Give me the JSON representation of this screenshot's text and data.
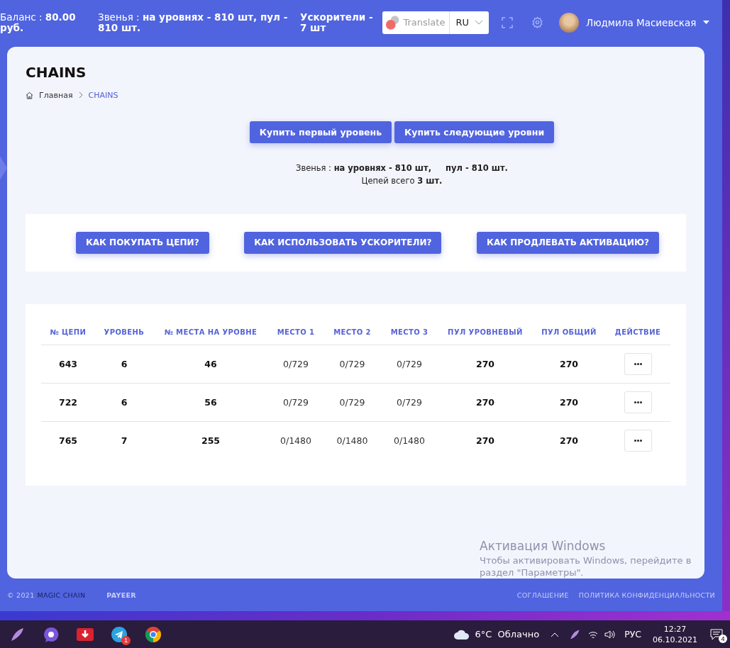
{
  "header": {
    "balance": "Баланс : **80.00 руб.**",
    "links": "Звенья : **на уровнях - 810 шт,     пул - 810 шт.**",
    "boosters": "Ускорители - 7 шт",
    "translate": {
      "label": "Translate",
      "language": "RU"
    },
    "user": {
      "name": "Людмила Масиевская"
    }
  },
  "page": {
    "title": "CHAINS",
    "breadcrumb": [
      {
        "label": "Главная",
        "current": false
      },
      {
        "label": "CHAINS",
        "current": true
      }
    ]
  },
  "buy_buttons": [
    "Купить первый уровень",
    "Купить следующие уровни"
  ],
  "summary": [
    "Звенья : **на уровнях - 810 шт,     пул - 810 шт.**",
    "Цепей всего **3 шт.**"
  ],
  "help_buttons": [
    "КАК ПОКУПАТЬ ЦЕПИ?",
    "КАК ИСПОЛЬЗОВАТЬ УСКОРИТЕЛИ?",
    "КАК ПРОДЛЕВАТЬ АКТИВАЦИЮ?"
  ],
  "table": {
    "columns": [
      {
        "label": "№ ЦЕПИ",
        "kind": "strong"
      },
      {
        "label": "УРОВЕНЬ",
        "kind": "strong"
      },
      {
        "label": "№ МЕСТА НА УРОВНЕ",
        "kind": "strong"
      },
      {
        "label": "МЕСТО 1",
        "kind": "plain"
      },
      {
        "label": "МЕСТО 2",
        "kind": "plain"
      },
      {
        "label": "МЕСТО 3",
        "kind": "plain"
      },
      {
        "label": "ПУЛ УРОВНЕВЫЙ",
        "kind": "strong"
      },
      {
        "label": "ПУЛ ОБЩИЙ",
        "kind": "strong"
      },
      {
        "label": "ДЕЙСТВИЕ",
        "kind": "action"
      }
    ],
    "rows": [
      {
        "cells": [
          "643",
          "6",
          "46",
          "0/729",
          "0/729",
          "0/729",
          "270",
          "270"
        ]
      },
      {
        "cells": [
          "722",
          "6",
          "56",
          "0/729",
          "0/729",
          "0/729",
          "270",
          "270"
        ]
      },
      {
        "cells": [
          "765",
          "7",
          "255",
          "0/1480",
          "0/1480",
          "0/1480",
          "270",
          "270"
        ]
      }
    ]
  },
  "footer": {
    "copyright": "© 2021",
    "brand": "MAGIC CHAIN",
    "payment": "PAYEER",
    "links": [
      "СОГЛАШЕНИЕ",
      "ПОЛИТИКА КОНФИДЕНЦИАЛЬНОСТИ"
    ]
  },
  "activation": {
    "title": "Активация Windows",
    "text": "Чтобы активировать Windows, перейдите в раздел \"Параметры\"."
  },
  "taskbar": {
    "apps": [
      {
        "kind": "feather"
      },
      {
        "kind": "viber"
      },
      {
        "kind": "download"
      },
      {
        "kind": "telegram",
        "badge": "1"
      },
      {
        "kind": "chrome"
      }
    ],
    "weather": {
      "temperature": "6°C",
      "condition": "Облачно"
    },
    "language": "РУС",
    "time": "12:27",
    "date": "06.10.2021",
    "notifications": "4"
  }
}
